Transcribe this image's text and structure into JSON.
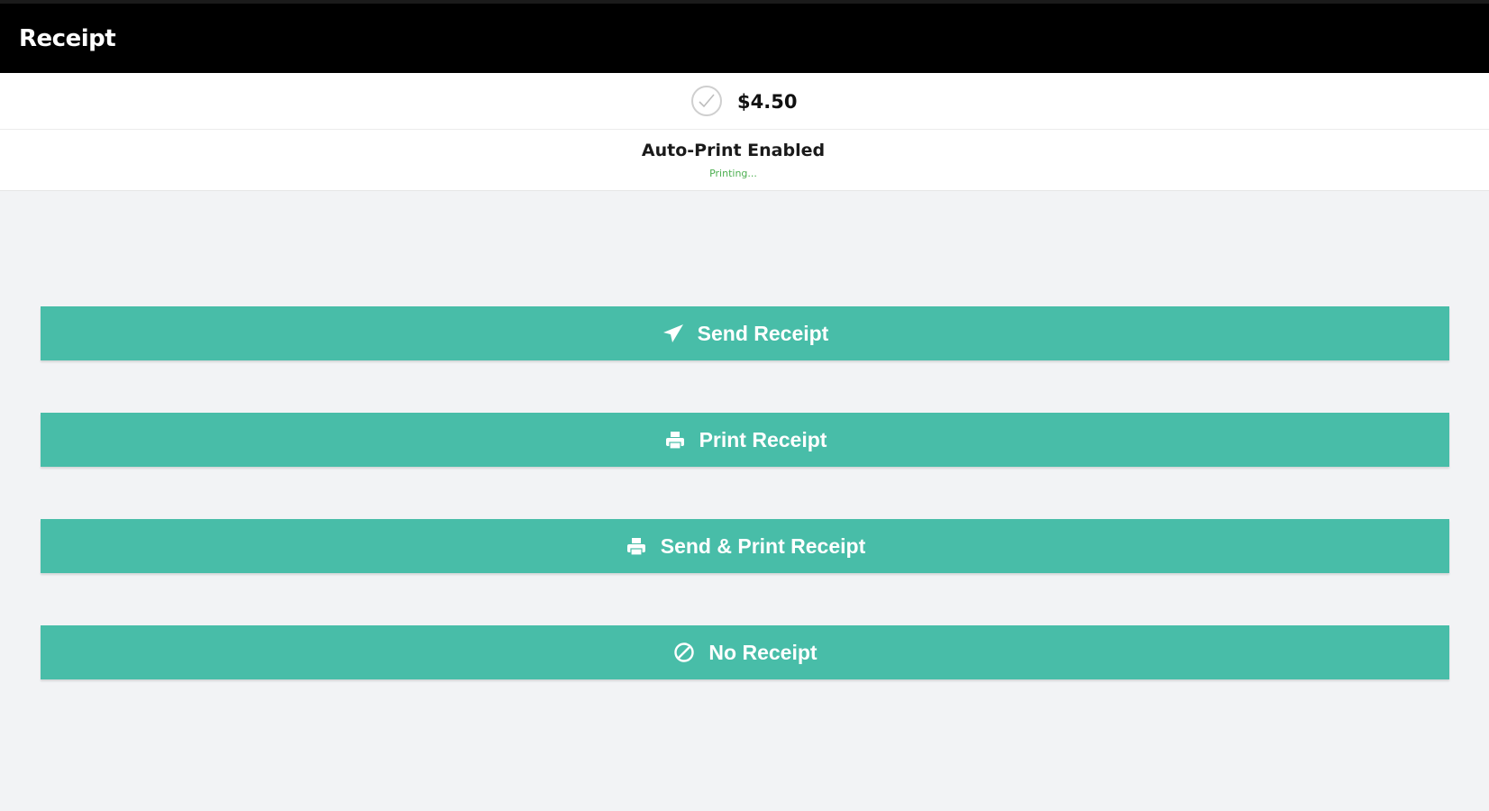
{
  "header": {
    "title": "Receipt"
  },
  "payment": {
    "amount": "$4.50",
    "status_icon": "check-circle-icon"
  },
  "print_status": {
    "title": "Auto-Print Enabled",
    "status": "Printing..."
  },
  "actions": [
    {
      "label": "Send Receipt",
      "icon": "paper-plane-icon"
    },
    {
      "label": "Print Receipt",
      "icon": "printer-icon"
    },
    {
      "label": "Send & Print Receipt",
      "icon": "printer-icon"
    },
    {
      "label": "No Receipt",
      "icon": "ban-icon"
    }
  ],
  "colors": {
    "header_bg": "#000000",
    "button_bg": "#48bda8",
    "button_text": "#ffffff",
    "printing_text": "#4caf50",
    "page_bg": "#f2f3f5"
  }
}
